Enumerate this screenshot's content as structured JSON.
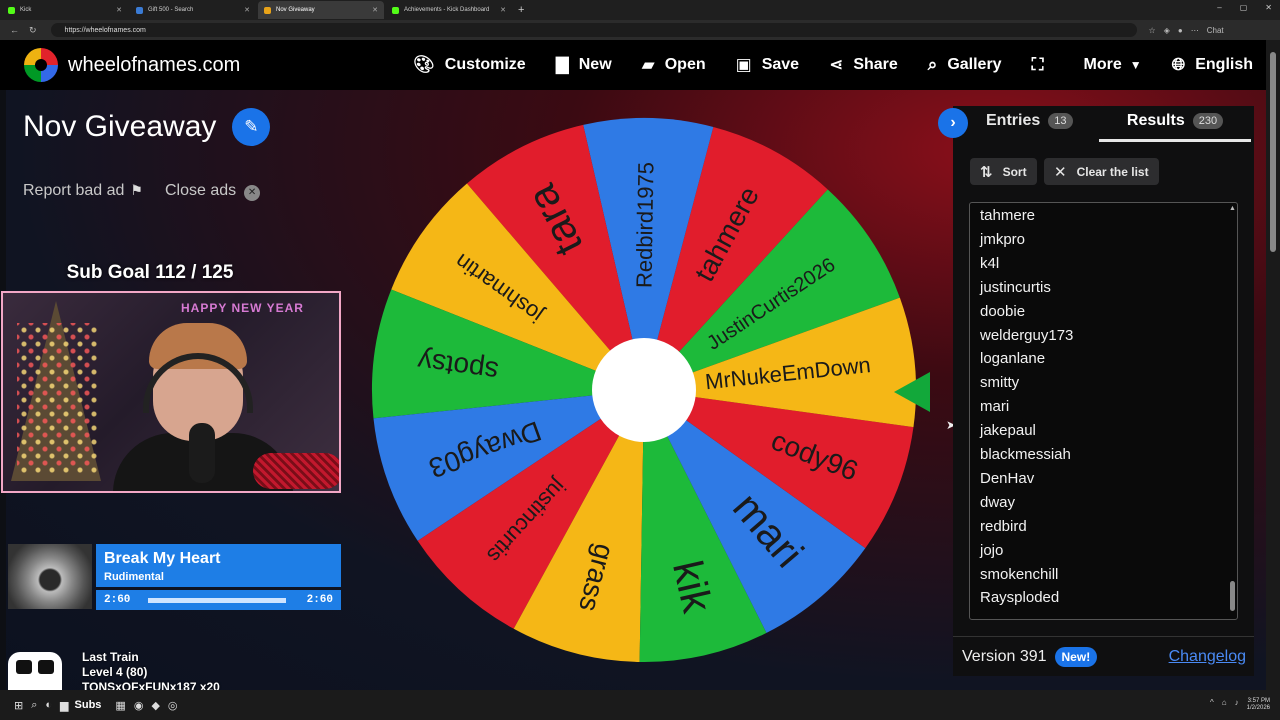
{
  "browser": {
    "tabs": [
      {
        "label": "Kick",
        "color": "#53fc18"
      },
      {
        "label": "Gift 500 - Search",
        "color": "#3a7bd5"
      },
      {
        "label": "Nov Giveaway",
        "color": "#e8a319"
      },
      {
        "label": "Achievements - Kick Dashboard",
        "color": "#53fc18"
      }
    ],
    "url": "https://wheelofnames.com",
    "chat_label": "Chat"
  },
  "site": {
    "name": "wheelofnames.com",
    "menu": [
      {
        "label": "Customize",
        "icon": "palette-icon"
      },
      {
        "label": "New",
        "icon": "file-icon"
      },
      {
        "label": "Open",
        "icon": "folder-open-icon"
      },
      {
        "label": "Save",
        "icon": "save-icon"
      },
      {
        "label": "Share",
        "icon": "share-icon"
      },
      {
        "label": "Gallery",
        "icon": "search-icon"
      },
      {
        "label": "",
        "icon": "fullscreen-icon"
      },
      {
        "label": "More",
        "icon": "caret-down-icon"
      },
      {
        "label": "English",
        "icon": "globe-icon"
      }
    ]
  },
  "page": {
    "title": "Nov Giveaway",
    "report_ad": "Report bad ad",
    "close_ads": "Close ads"
  },
  "overlay": {
    "sub_goal": "Sub Goal  112 / 125",
    "webcam_banner": "HAPPY NEW YEAR",
    "now_playing": {
      "title": "Break My Heart",
      "artist": "Rudimental",
      "elapsed": "2:60",
      "total": "2:60",
      "progress": 1.0
    },
    "train": {
      "name": "Last Train",
      "level": "Level 4 (80)",
      "user": "TONSxOFxFUNx187 x20"
    }
  },
  "wheel": {
    "segments": [
      {
        "label": "JustinCurtis2026",
        "color": "#1dba3a"
      },
      {
        "label": "tahmere",
        "color": "#e11d2c"
      },
      {
        "label": "Redbird1975",
        "color": "#2f7ae5"
      },
      {
        "label": "tara",
        "color": "#e11d2c"
      },
      {
        "label": "joshmartin",
        "color": "#f5b716"
      },
      {
        "label": "spotsy",
        "color": "#1dba3a"
      },
      {
        "label": "Dwayg03",
        "color": "#2f7ae5"
      },
      {
        "label": "justincurtis",
        "color": "#e11d2c"
      },
      {
        "label": "grass",
        "color": "#f5b716"
      },
      {
        "label": "kik",
        "color": "#1dba3a"
      },
      {
        "label": "mari",
        "color": "#2f7ae5"
      },
      {
        "label": "cody96",
        "color": "#e11d2c"
      },
      {
        "label": "MrNukeEmDown",
        "color": "#f5b716"
      }
    ]
  },
  "panel": {
    "entries_label": "Entries",
    "entries_count": "13",
    "results_label": "Results",
    "results_count": "230",
    "sort_label": "Sort",
    "clear_label": "Clear the list",
    "results": [
      "tahmere",
      "jmkpro",
      "k4l",
      "justincurtis",
      "doobie",
      "welderguy173",
      "loganlane",
      "smitty",
      "mari",
      "jakepaul",
      "blackmessiah",
      "DenHav",
      "dway",
      "redbird",
      "jojo",
      "smokenchill",
      "Raysploded"
    ],
    "version": "Version 391",
    "new_badge": "New!",
    "changelog": "Changelog"
  },
  "taskbar": {
    "subs_label": "Subs",
    "time": "3:57 PM",
    "date": "1/2/2026"
  }
}
